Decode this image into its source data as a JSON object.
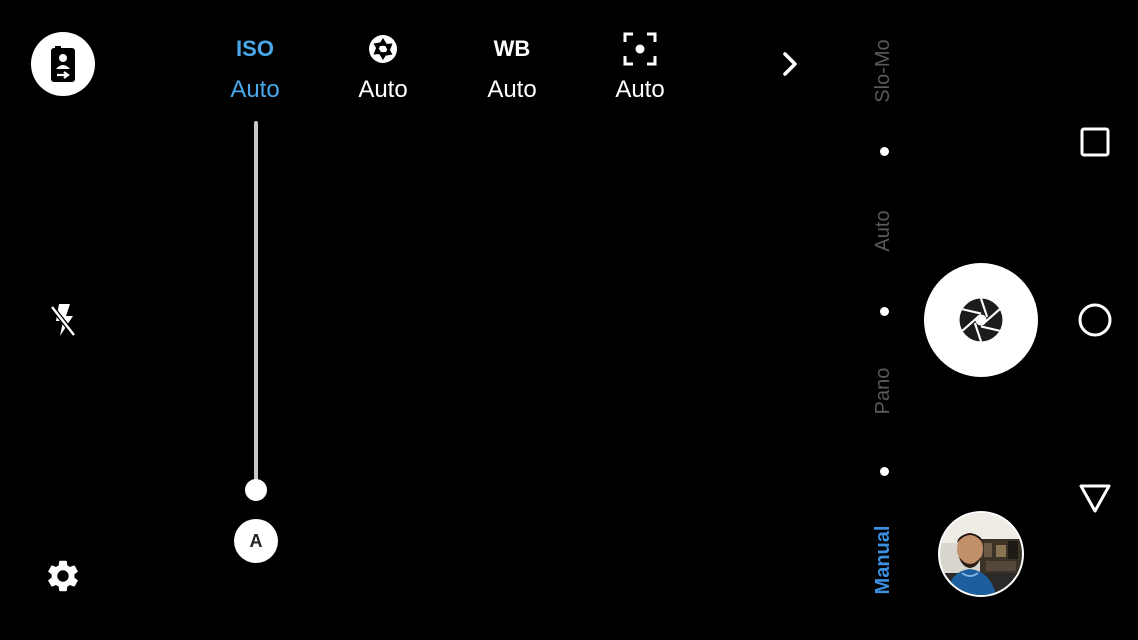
{
  "controls": [
    {
      "id": "iso",
      "label": "ISO",
      "value": "Auto",
      "active": true
    },
    {
      "id": "shutter-speed",
      "icon": "aperture-icon",
      "value": "Auto",
      "active": false
    },
    {
      "id": "white-balance",
      "label": "WB",
      "value": "Auto",
      "active": false
    },
    {
      "id": "focus",
      "icon": "focus-frame-icon",
      "value": "Auto",
      "active": false
    }
  ],
  "slider": {
    "auto_badge": "A",
    "level": 0
  },
  "modes": [
    {
      "label": "Slo-Mo",
      "active": false
    },
    {
      "label": "Auto",
      "active": false
    },
    {
      "label": "Pano",
      "active": false
    },
    {
      "label": "Manual",
      "active": true
    }
  ],
  "icons": {
    "switch_camera": "switch-camera-icon",
    "flash": "flash-off-icon",
    "settings": "gear-icon",
    "more": "chevron-right-icon",
    "shutter": "aperture-icon",
    "recents": "square-icon",
    "home": "circle-icon",
    "back": "triangle-icon"
  },
  "colors": {
    "background": "#000000",
    "active_accent": "#4aa8ea",
    "mode_active": "#3d8fe0",
    "mode_inactive": "#5a5a5a",
    "foreground": "#ffffff"
  }
}
